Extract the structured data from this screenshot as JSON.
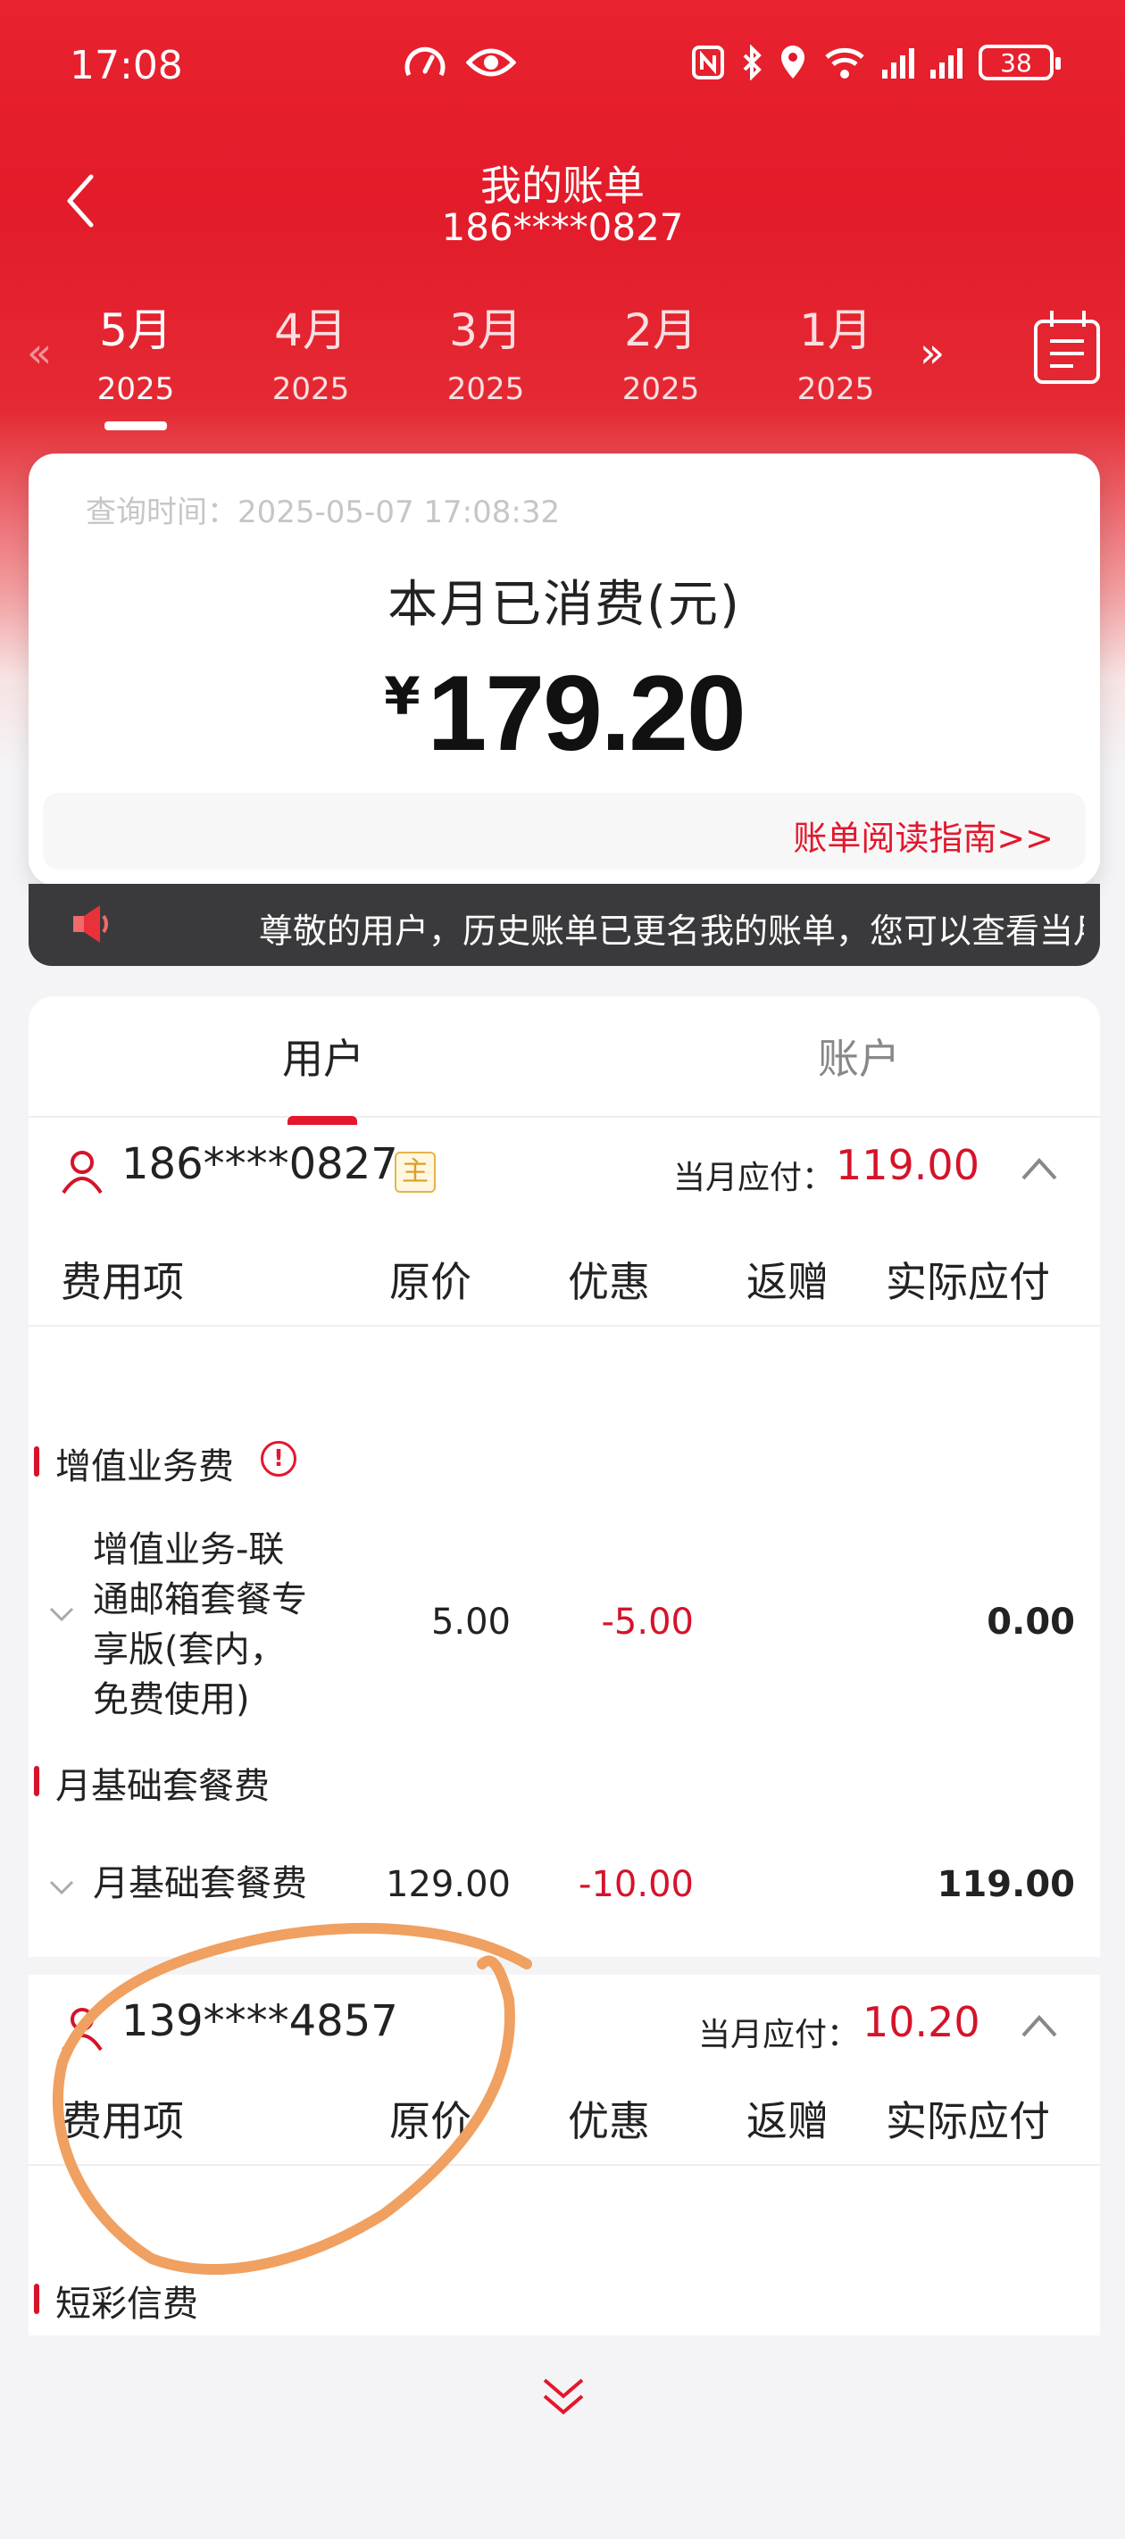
{
  "status": {
    "time": "17:08",
    "battery": "38"
  },
  "header": {
    "title": "我的账单",
    "subtitle": "186****0827"
  },
  "months": [
    {
      "month": "5月",
      "year": "2025"
    },
    {
      "month": "4月",
      "year": "2025"
    },
    {
      "month": "3月",
      "year": "2025"
    },
    {
      "month": "2月",
      "year": "2025"
    },
    {
      "month": "1月",
      "year": "2025"
    }
  ],
  "month_nav": {
    "prev": "«",
    "next": "»"
  },
  "summary": {
    "query_time": "查询时间：2025-05-07 17:08:32",
    "spent_label": "本月已消费(元)",
    "currency": "¥",
    "amount": "179.20",
    "guide_link": "账单阅读指南>>"
  },
  "notice": {
    "text": "尊敬的用户，历史账单已更名我的账单，您可以查看当月"
  },
  "tabs": [
    "用户",
    "账户"
  ],
  "table_headers": [
    "费用项",
    "原价",
    "优惠",
    "返赠",
    "实际应付"
  ],
  "users": [
    {
      "phone": "186****0827",
      "badge": "主",
      "due_label": "当月应付：",
      "due_value": "119.00",
      "categories": [
        {
          "name": "增值业务费",
          "warn": "!",
          "items": [
            {
              "lines": [
                "增值业务-联",
                "通邮箱套餐专",
                "享版(套内，",
                "免费使用)"
              ],
              "orig": "5.00",
              "disc": "-5.00",
              "pay": "0.00"
            }
          ]
        },
        {
          "name": "月基础套餐费",
          "items": [
            {
              "lines": [
                "月基础套餐费"
              ],
              "orig": "129.00",
              "disc": "-10.00",
              "pay": "119.00"
            }
          ]
        }
      ]
    },
    {
      "phone": "139****4857",
      "due_label": "当月应付：",
      "due_value": "10.20",
      "categories": [
        {
          "name": "短彩信费"
        }
      ]
    }
  ],
  "colors": {
    "brand_red": "#e3172d",
    "due_red": "#d5132a",
    "annotation": "#f0a060"
  }
}
